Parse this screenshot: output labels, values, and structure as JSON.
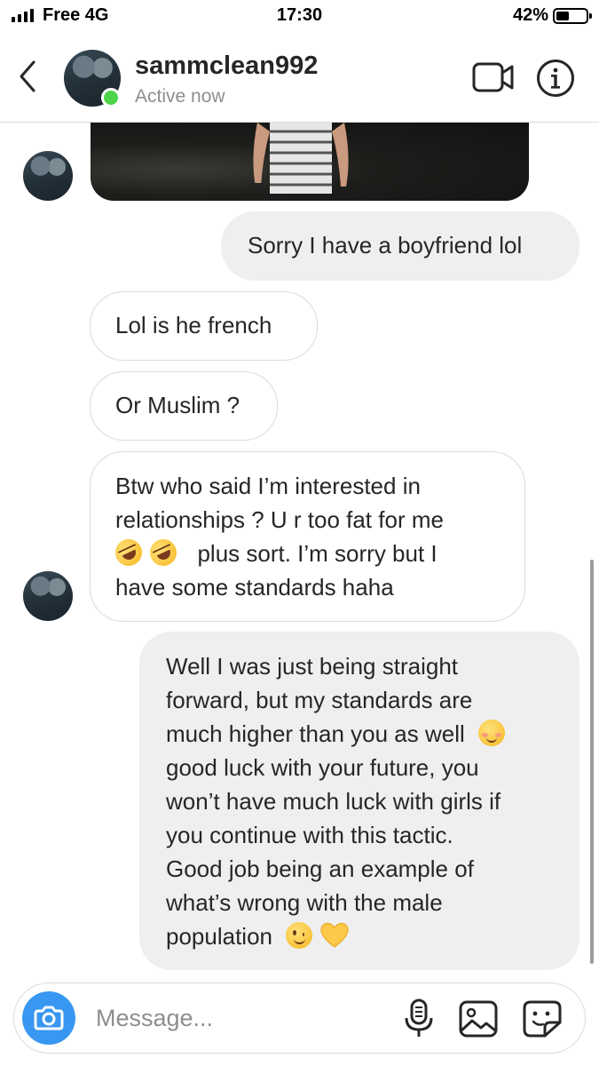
{
  "status_bar": {
    "carrier": "Free 4G",
    "time": "17:30",
    "battery_percent": "42%",
    "battery_level": 0.42,
    "signal_bars": 4
  },
  "header": {
    "back_icon": "chevron-left-icon",
    "username": "sammclean992",
    "status": "Active now",
    "video_call_icon": "video-camera-icon",
    "info_icon": "info-icon"
  },
  "messages": [
    {
      "direction": "incoming",
      "type": "photo"
    },
    {
      "direction": "outgoing",
      "lines": [
        "Sorry I have a boyfriend lol"
      ]
    },
    {
      "direction": "incoming",
      "lines": [
        "Lol is he french"
      ]
    },
    {
      "direction": "incoming",
      "lines": [
        "Or Muslim ?"
      ]
    },
    {
      "direction": "incoming",
      "lines": [
        "Btw who said I’m interested in",
        "relationships ?  U r too fat for me",
        "plus sort. I’m sorry but I",
        "have some standards haha"
      ],
      "emoji": [
        "rolling-on-floor-laughing",
        "rolling-on-floor-laughing"
      ]
    },
    {
      "direction": "outgoing",
      "lines": [
        "Well I was just being straight",
        "forward, but my standards are",
        "much higher than you as well",
        "good luck with your future, you",
        "won’t have much luck with girls if",
        "you continue with this tactic.",
        "Good job being an example of",
        "what’s wrong with the male",
        "population"
      ],
      "emoji": [
        "smiling-face",
        "winking-face",
        "yellow-heart"
      ]
    }
  ],
  "composer": {
    "placeholder": "Message...",
    "camera_icon": "camera-icon",
    "mic_icon": "microphone-icon",
    "gallery_icon": "image-icon",
    "sticker_icon": "sticker-icon"
  },
  "colors": {
    "accent": "#3897f0",
    "active_dot": "#4cd548",
    "outgoing_bubble": "#efefef",
    "incoming_border": "#dbdbdb",
    "secondary_text": "#8e8e8e"
  }
}
